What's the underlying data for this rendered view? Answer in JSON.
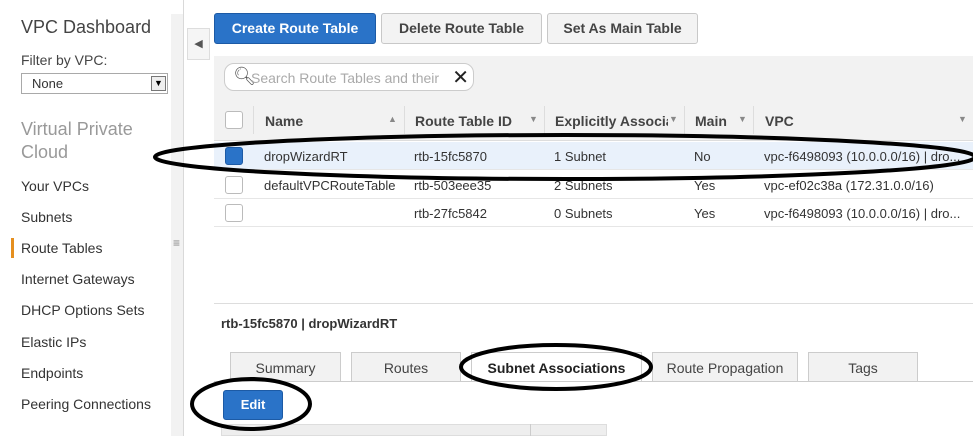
{
  "sidebar": {
    "title": "VPC Dashboard",
    "filter_label": "Filter by VPC:",
    "filter_value": "None",
    "section_title_line1": "Virtual Private",
    "section_title_line2": "Cloud",
    "items": [
      {
        "label": "Your VPCs"
      },
      {
        "label": "Subnets"
      },
      {
        "label": "Route Tables",
        "active": true
      },
      {
        "label": "Internet Gateways"
      },
      {
        "label": "DHCP Options Sets"
      },
      {
        "label": "Elastic IPs"
      },
      {
        "label": "Endpoints"
      },
      {
        "label": "Peering Connections"
      }
    ]
  },
  "toolbar": {
    "create_label": "Create Route Table",
    "delete_label": "Delete Route Table",
    "set_main_label": "Set As Main Table"
  },
  "search": {
    "placeholder": "Search Route Tables and their"
  },
  "table": {
    "columns": [
      "Name",
      "Route Table ID",
      "Explicitly Associat",
      "Main",
      "VPC"
    ],
    "rows": [
      {
        "name": "dropWizardRT",
        "id": "rtb-15fc5870",
        "assoc": "1 Subnet",
        "main": "No",
        "vpc": "vpc-f6498093 (10.0.0.0/16) | dro...",
        "selected": true
      },
      {
        "name": "defaultVPCRouteTable",
        "id": "rtb-503eee35",
        "assoc": "2 Subnets",
        "main": "Yes",
        "vpc": "vpc-ef02c38a (172.31.0.0/16)",
        "selected": false
      },
      {
        "name": "",
        "id": "rtb-27fc5842",
        "assoc": "0 Subnets",
        "main": "Yes",
        "vpc": "vpc-f6498093 (10.0.0.0/16) | dro...",
        "selected": false
      }
    ]
  },
  "detail": {
    "title": "rtb-15fc5870 | dropWizardRT",
    "tabs": [
      "Summary",
      "Routes",
      "Subnet Associations",
      "Route Propagation",
      "Tags"
    ],
    "active_tab": "Subnet Associations",
    "edit_label": "Edit"
  },
  "colors": {
    "primary": "#2a73c8",
    "active_nav": "#e58f1f"
  }
}
